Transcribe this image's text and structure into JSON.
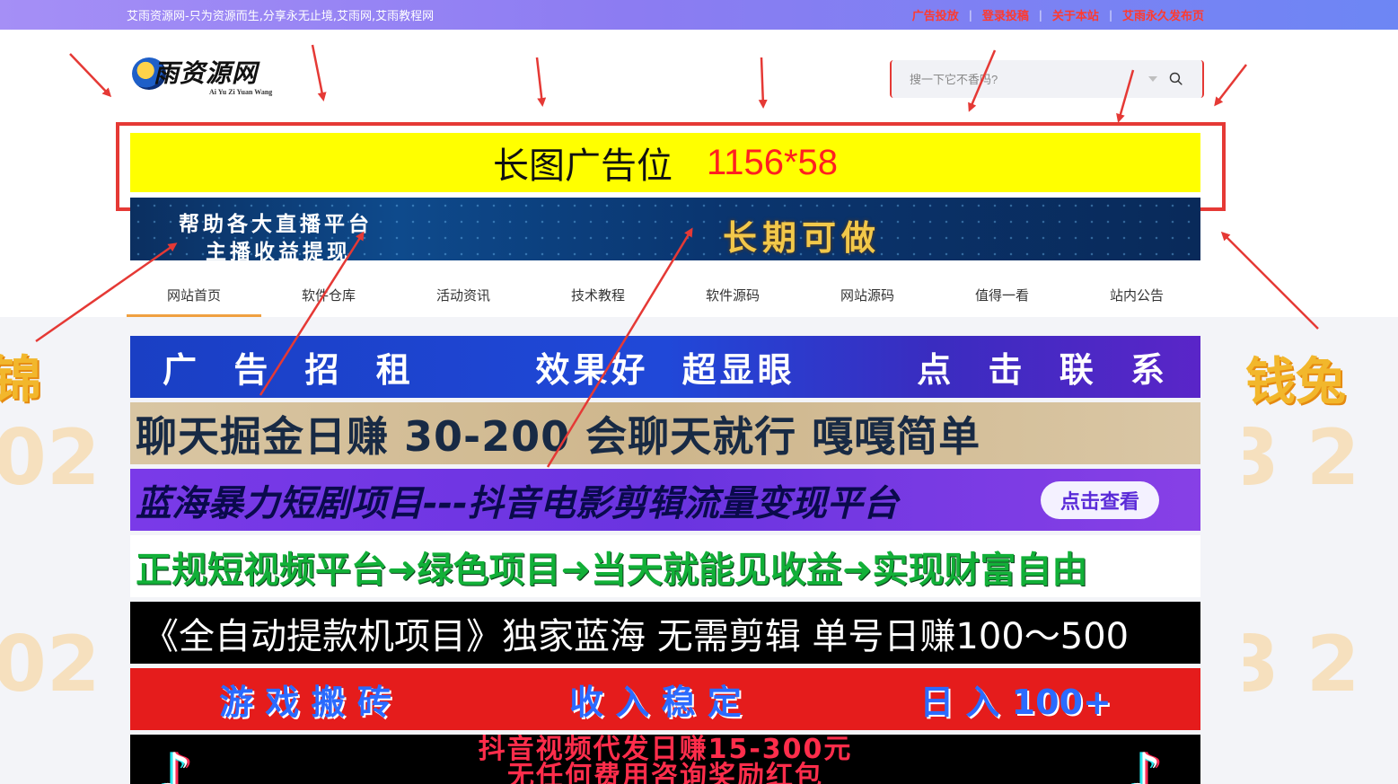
{
  "topbar": {
    "slogan": "艾雨资源网-只为资源而生,分享永无止境,艾雨网,艾雨教程网",
    "links": [
      "广告投放",
      "登录投稿",
      "关于本站",
      "艾雨永久发布页"
    ],
    "link_color": "#ff3a2f"
  },
  "logo": {
    "text": "雨资源网",
    "sub": "Ai Yu Zi Yuan Wang"
  },
  "search": {
    "placeholder": "搜一下它不香吗?",
    "icon": "search-icon"
  },
  "ad_slot": {
    "label": "长图广告位",
    "size": "1156*58"
  },
  "live_ad": {
    "line1": "帮助各大直播平台",
    "line2": "主播收益提现",
    "slogan": "长期可做"
  },
  "nav": {
    "items": [
      "网站首页",
      "软件仓库",
      "活动资讯",
      "技术教程",
      "软件源码",
      "网站源码",
      "值得一看",
      "站内公告"
    ],
    "active_index": 0,
    "accent": "#f0a040"
  },
  "banners": {
    "b1": {
      "parts": [
        "广 告 招 租",
        "效果好 超显眼",
        "点 击 联 系"
      ]
    },
    "b2": {
      "text": "聊天掘金日赚 30-200 会聊天就行 嘎嘎简单"
    },
    "b3": {
      "text": "蓝海暴力短剧项目---抖音电影剪辑流量变现平台",
      "button": "点击查看"
    },
    "b4": {
      "text": "正规短视频平台➜绿色项目➜当天就能见收益➜实现财富自由"
    },
    "b5": {
      "text": "《全自动提款机项目》独家蓝海 无需剪辑 单号日赚100～500"
    },
    "b6": {
      "parts": [
        "游 戏 搬 砖",
        "收 入 稳 定",
        "日 入 100+"
      ]
    },
    "b7": {
      "line1": "抖音视频代发日赚15-300元",
      "line2": "无任何费用咨询奖励红包"
    }
  },
  "decorations": {
    "left": "锦",
    "right": "钱兔"
  }
}
